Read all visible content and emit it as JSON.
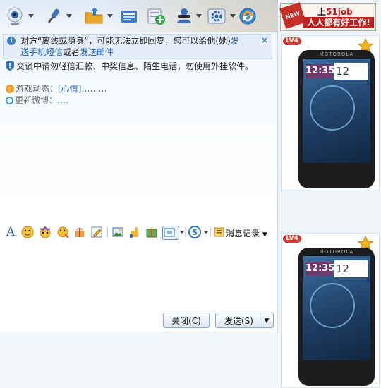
{
  "toolbar": {
    "items": [
      {
        "name": "video-call",
        "icon": "webcam-icon"
      },
      {
        "name": "voice-call",
        "icon": "microphone-icon"
      },
      {
        "name": "send-file",
        "icon": "folder-icon"
      },
      {
        "name": "send-sms",
        "icon": "envelope-icon"
      },
      {
        "name": "add-app",
        "icon": "green-plus-icon"
      },
      {
        "name": "invite",
        "icon": "user-group-icon"
      },
      {
        "name": "settings",
        "icon": "gear-icon"
      },
      {
        "name": "remote-assist",
        "icon": "globe-arrow-icon"
      }
    ]
  },
  "notice": {
    "text_before": "对方“离线或隐身”，可能无法立即回复，您可以给他(她)",
    "link_sms": "发送手机短信",
    "text_middle": "或者",
    "link_mail": "发送邮件",
    "close": "×"
  },
  "warning": {
    "text": "交谈中请勿轻信汇款、中奖信息、陌生电话，勿使用外挂软件。"
  },
  "feeds": [
    {
      "label": "游戏动态：",
      "link": "[心情]",
      "tail": "………"
    },
    {
      "label": "更新微博：",
      "link": "….",
      "tail": ""
    }
  ],
  "format_bar": {
    "message_record": "消息记录"
  },
  "buttons": {
    "close": "关闭(C)",
    "send": "发送(S)"
  },
  "ads": {
    "top": {
      "tag": "NEW",
      "line1_pre": "上",
      "line1_brand": "51job",
      "line2": "人人都有好工作!"
    },
    "phone_cards": [
      {
        "level": "LV4",
        "more": "…",
        "brand": "MOTOROLA",
        "time": "12:35",
        "date": "12"
      },
      {
        "level": "LV4",
        "more": "…",
        "brand": "MOTOROLA",
        "time": "12:35",
        "date": "12"
      }
    ]
  },
  "colors": {
    "link": "#1f5fb8",
    "notice_bg": "#e3eefa",
    "accent_red": "#d53a2a"
  }
}
